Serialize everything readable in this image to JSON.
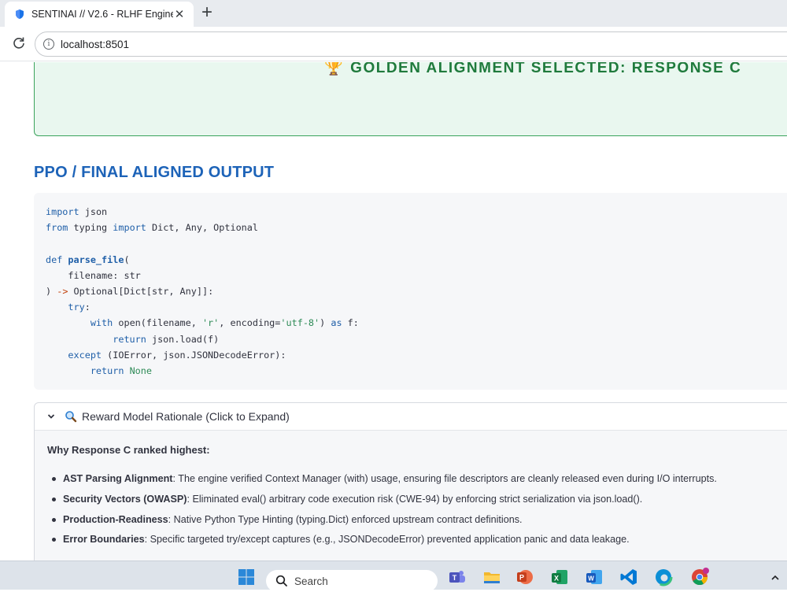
{
  "browser": {
    "tab_title": "SENTINAI // V2.6 - RLHF Engine",
    "close_glyph": "✕",
    "new_tab_glyph": "+",
    "url": "localhost:8501",
    "info_glyph": "i"
  },
  "banner": {
    "text": "GOLDEN ALIGNMENT SELECTED: RESPONSE C",
    "icon": "trophy-icon"
  },
  "section_title": "PPO / FINAL ALIGNED OUTPUT",
  "code": {
    "language": "python",
    "lines": [
      "import json",
      "from typing import Dict, Any, Optional",
      "",
      "def parse_file(",
      "    filename: str",
      ") -> Optional[Dict[str, Any]]:",
      "    try:",
      "        with open(filename, 'r', encoding='utf-8') as f:",
      "            return json.load(f)",
      "    except (IOError, json.JSONDecodeError):",
      "        return None"
    ]
  },
  "expander": {
    "title": "Reward Model Rationale (Click to Expand)",
    "heading": "Why Response C ranked highest:",
    "bullets": [
      {
        "term": "AST Parsing Alignment",
        "text": ": The engine verified Context Manager (with) usage, ensuring file descriptors are cleanly released even during I/O interrupts."
      },
      {
        "term": "Security Vectors (OWASP)",
        "text": ": Eliminated eval() arbitrary code execution risk (CWE-94) by enforcing strict serialization via json.load()."
      },
      {
        "term": "Production-Readiness",
        "text": ": Native Python Type Hinting (typing.Dict) enforced upstream contract definitions."
      },
      {
        "term": "Error Boundaries",
        "text": ": Specific targeted try/except captures (e.g., JSONDecodeError) prevented application panic and data leakage."
      }
    ]
  },
  "taskbar": {
    "search_label": "Search",
    "icons": [
      "windows-start-icon",
      "search-icon",
      "teams-icon",
      "file-explorer-icon",
      "powerpoint-icon",
      "excel-icon",
      "word-icon",
      "vscode-icon",
      "edge-icon",
      "chrome-icon",
      "tray-chevron-icon"
    ]
  },
  "colors": {
    "accent_blue": "#1d63b8",
    "success_green": "#1f7a3c",
    "success_bg": "#e9f7ef",
    "code_bg": "#f6f7f9"
  }
}
